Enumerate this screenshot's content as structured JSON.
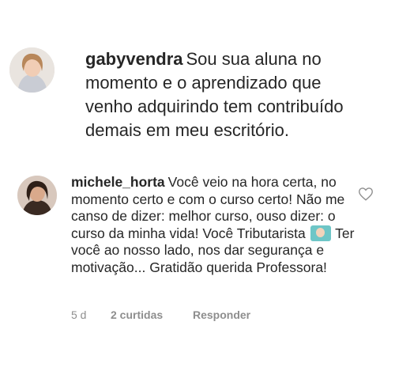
{
  "comments": [
    {
      "username": "gabyvendra",
      "text": "Sou sua aluna no momento e o aprendizado que venho adquirindo tem contribuído demais em meu escritório."
    },
    {
      "username": "michele_horta",
      "text_before_emoji": "Você veio na hora certa, no momento certo e com o curso certo! Não me canso de dizer: melhor curso, ouso dizer: o curso da minha vida! Você Tributarista",
      "emoji": "woman-teacher-emoji",
      "text_after_emoji": "Ter você ao nosso lado, nos dar segurança e motivação... Gratidão querida Professora!",
      "time": "5 d",
      "likes": "2 curtidas",
      "reply": "Responder"
    }
  ],
  "icons": {
    "like": "heart-outline-icon"
  },
  "colors": {
    "text": "#262626",
    "meta": "#8e8e8e"
  }
}
